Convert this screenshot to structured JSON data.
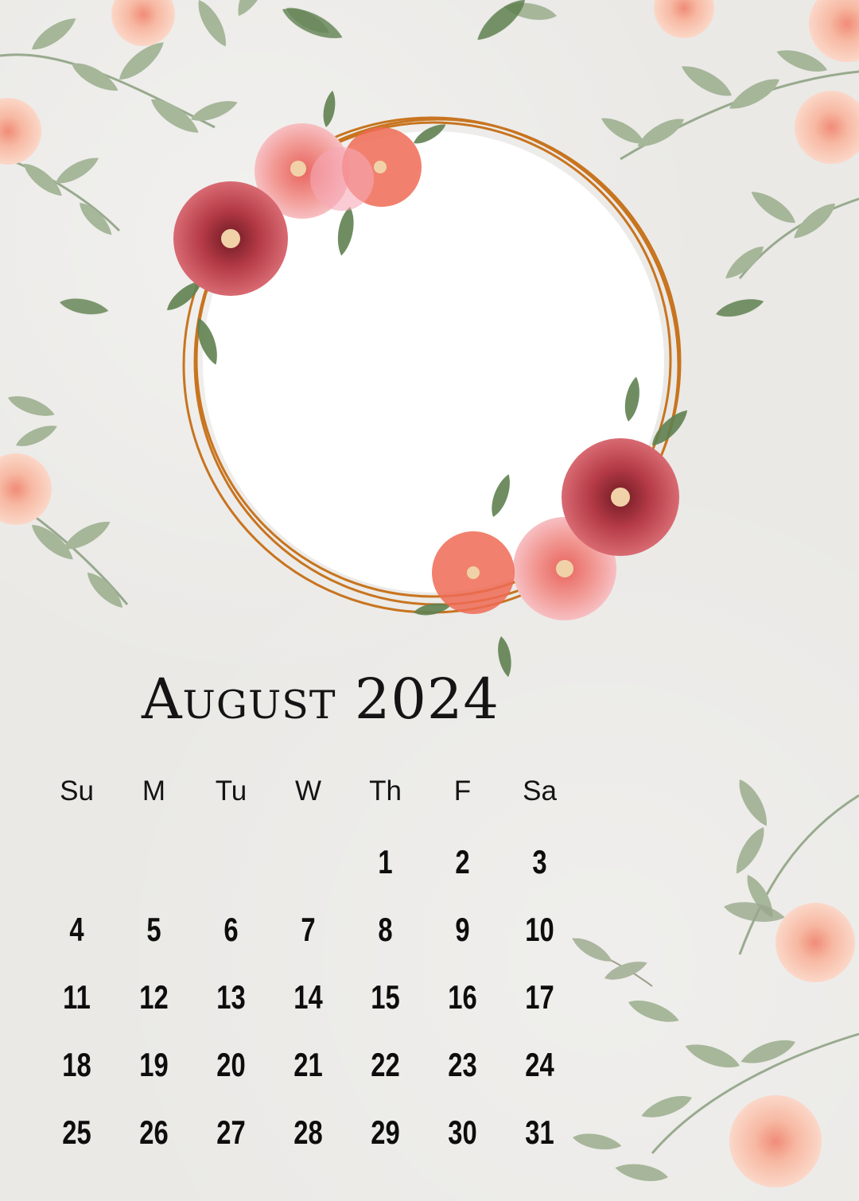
{
  "calendar": {
    "month": "August",
    "year": "2024",
    "weekdays": [
      "Su",
      "M",
      "Tu",
      "W",
      "Th",
      "F",
      "Sa"
    ],
    "weeks": [
      [
        "",
        "",
        "",
        "",
        "1",
        "2",
        "3"
      ],
      [
        "4",
        "5",
        "6",
        "7",
        "8",
        "9",
        "10"
      ],
      [
        "11",
        "12",
        "13",
        "14",
        "15",
        "16",
        "17"
      ],
      [
        "18",
        "19",
        "20",
        "21",
        "22",
        "23",
        "24"
      ],
      [
        "25",
        "26",
        "27",
        "28",
        "29",
        "30",
        "31"
      ]
    ]
  },
  "colors": {
    "background": "#eae9e6",
    "frame_ring": "#c8741f",
    "text": "#141414",
    "leaf": "#7f9a6c",
    "peach_rose": "#f6b7a1",
    "red_flower": "#b03a48",
    "pink_flower": "#ef8f9a"
  }
}
